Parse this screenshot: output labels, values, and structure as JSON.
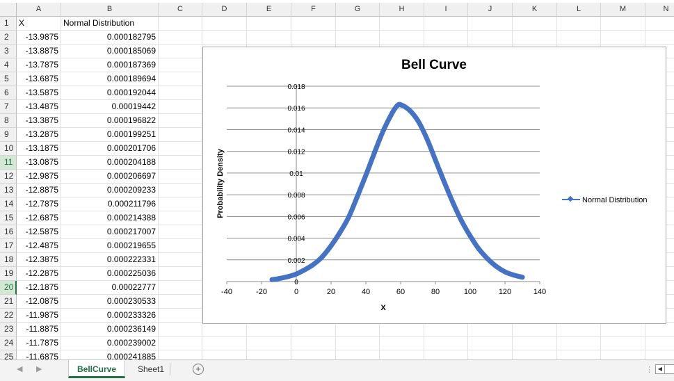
{
  "columns": [
    "A",
    "B",
    "C",
    "D",
    "E",
    "F",
    "G",
    "H",
    "I",
    "J",
    "K",
    "L",
    "M",
    "N"
  ],
  "header_row": {
    "row": "1",
    "col_a": "X",
    "col_b": "Normal Distribution"
  },
  "rows": [
    {
      "row": "2",
      "x": "-13.9875",
      "y": "0.000182795"
    },
    {
      "row": "3",
      "x": "-13.8875",
      "y": "0.000185069"
    },
    {
      "row": "4",
      "x": "-13.7875",
      "y": "0.000187369"
    },
    {
      "row": "5",
      "x": "-13.6875",
      "y": "0.000189694"
    },
    {
      "row": "6",
      "x": "-13.5875",
      "y": "0.000192044"
    },
    {
      "row": "7",
      "x": "-13.4875",
      "y": "0.00019442"
    },
    {
      "row": "8",
      "x": "-13.3875",
      "y": "0.000196822"
    },
    {
      "row": "9",
      "x": "-13.2875",
      "y": "0.000199251"
    },
    {
      "row": "10",
      "x": "-13.1875",
      "y": "0.000201706"
    },
    {
      "row": "11",
      "x": "-13.0875",
      "y": "0.000204188"
    },
    {
      "row": "12",
      "x": "-12.9875",
      "y": "0.000206697"
    },
    {
      "row": "13",
      "x": "-12.8875",
      "y": "0.000209233"
    },
    {
      "row": "14",
      "x": "-12.7875",
      "y": "0.000211796"
    },
    {
      "row": "15",
      "x": "-12.6875",
      "y": "0.000214388"
    },
    {
      "row": "16",
      "x": "-12.5875",
      "y": "0.000217007"
    },
    {
      "row": "17",
      "x": "-12.4875",
      "y": "0.000219655"
    },
    {
      "row": "18",
      "x": "-12.3875",
      "y": "0.000222331"
    },
    {
      "row": "19",
      "x": "-12.2875",
      "y": "0.000225036"
    },
    {
      "row": "20",
      "x": "-12.1875",
      "y": "0.00022777"
    },
    {
      "row": "21",
      "x": "-12.0875",
      "y": "0.000230533"
    },
    {
      "row": "22",
      "x": "-11.9875",
      "y": "0.000233326"
    },
    {
      "row": "23",
      "x": "-11.8875",
      "y": "0.000236149"
    },
    {
      "row": "24",
      "x": "-11.7875",
      "y": "0.000239002"
    },
    {
      "row": "25",
      "x": "-11.6875",
      "y": "0.000241885"
    }
  ],
  "selection": {
    "selected_row": "20",
    "highlighted_row": "11"
  },
  "tabs": {
    "active": "BellCurve",
    "other": "Sheet1",
    "add_symbol": "+"
  },
  "colors": {
    "series": "#4472c4",
    "excel_green": "#217346"
  },
  "chart_data": {
    "type": "line",
    "title": "Bell Curve",
    "xlabel": "X",
    "ylabel": "Probability Density",
    "xlim": [
      -40,
      140
    ],
    "ylim": [
      0,
      0.018
    ],
    "xticks": [
      "-40",
      "-20",
      "0",
      "20",
      "40",
      "60",
      "80",
      "100",
      "120",
      "140"
    ],
    "yticks": [
      "0",
      "0.002",
      "0.004",
      "0.006",
      "0.008",
      "0.01",
      "0.012",
      "0.014",
      "0.016",
      "0.018"
    ],
    "grid": true,
    "legend_position": "right",
    "series": [
      {
        "name": "Normal Distribution",
        "color": "#4472c4",
        "marker": "diamond",
        "x": [
          -14,
          -10,
          -5,
          0,
          5,
          10,
          15,
          20,
          25,
          30,
          35,
          40,
          45,
          50,
          55,
          58,
          60,
          65,
          70,
          75,
          80,
          85,
          90,
          95,
          100,
          105,
          110,
          115,
          120,
          125,
          130
        ],
        "y": [
          0.00018,
          0.00028,
          0.00045,
          0.0007,
          0.0011,
          0.0016,
          0.0023,
          0.0033,
          0.0045,
          0.0059,
          0.0078,
          0.0098,
          0.0119,
          0.0139,
          0.0155,
          0.0162,
          0.0163,
          0.0158,
          0.0148,
          0.0132,
          0.0112,
          0.0092,
          0.0073,
          0.0056,
          0.0042,
          0.003,
          0.0021,
          0.0014,
          0.0009,
          0.0006,
          0.0004
        ]
      }
    ]
  }
}
